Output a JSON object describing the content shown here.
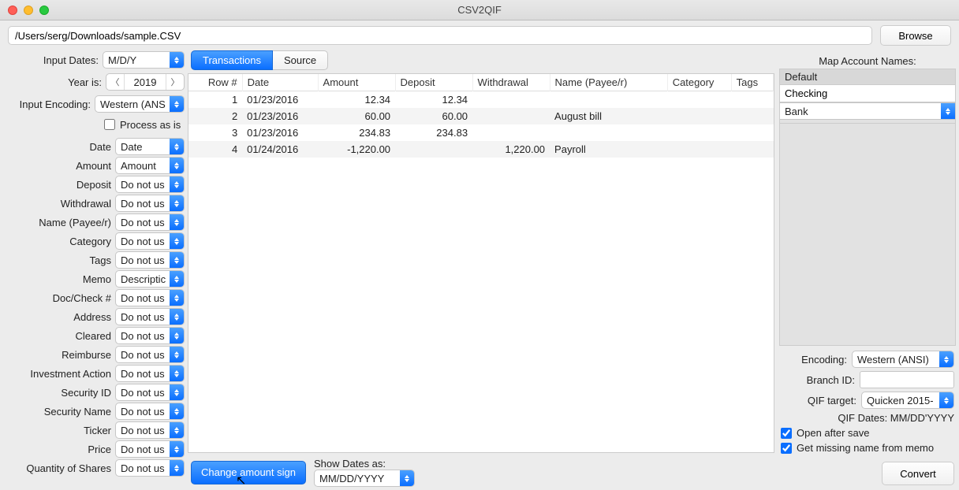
{
  "window": {
    "title": "CSV2QIF"
  },
  "path": {
    "value": "/Users/serg/Downloads/sample.CSV",
    "browse_label": "Browse"
  },
  "sidebar": {
    "input_dates_label": "Input Dates:",
    "input_dates_value": "M/D/Y",
    "year_label": "Year is:",
    "year_value": "2019",
    "encoding_label": "Input Encoding:",
    "encoding_value": "Western (ANS",
    "process_as_is_label": "Process as is",
    "fields": [
      {
        "label": "Date",
        "value": "Date"
      },
      {
        "label": "Amount",
        "value": "Amount"
      },
      {
        "label": "Deposit",
        "value": "Do not us"
      },
      {
        "label": "Withdrawal",
        "value": "Do not us"
      },
      {
        "label": "Name (Payee/r)",
        "value": "Do not us"
      },
      {
        "label": "Category",
        "value": "Do not us"
      },
      {
        "label": "Tags",
        "value": "Do not us"
      },
      {
        "label": "Memo",
        "value": "Descriptic"
      },
      {
        "label": "Doc/Check #",
        "value": "Do not us"
      },
      {
        "label": "Address",
        "value": "Do not us"
      },
      {
        "label": "Cleared",
        "value": "Do not us"
      },
      {
        "label": "Reimburse",
        "value": "Do not us"
      },
      {
        "label": "Investment Action",
        "value": "Do not us"
      },
      {
        "label": "Security ID",
        "value": "Do not us"
      },
      {
        "label": "Security Name",
        "value": "Do not us"
      },
      {
        "label": "Ticker",
        "value": "Do not us"
      },
      {
        "label": "Price",
        "value": "Do not us"
      },
      {
        "label": "Quantity of Shares",
        "value": "Do not us"
      }
    ]
  },
  "center": {
    "tabs": [
      "Transactions",
      "Source"
    ],
    "active_tab": 0,
    "columns": [
      "Row #",
      "Date",
      "Amount",
      "Deposit",
      "Withdrawal",
      "Name (Payee/r)",
      "Category",
      "Tags"
    ],
    "rows": [
      {
        "rownum": "1",
        "date": "01/23/2016",
        "amount": "12.34",
        "deposit": "12.34",
        "withdrawal": "",
        "name": "",
        "category": "",
        "tags": ""
      },
      {
        "rownum": "2",
        "date": "01/23/2016",
        "amount": "60.00",
        "deposit": "60.00",
        "withdrawal": "",
        "name": "August bill",
        "category": "",
        "tags": ""
      },
      {
        "rownum": "3",
        "date": "01/23/2016",
        "amount": "234.83",
        "deposit": "234.83",
        "withdrawal": "",
        "name": "",
        "category": "",
        "tags": ""
      },
      {
        "rownum": "4",
        "date": "01/24/2016",
        "amount": "-1,220.00",
        "deposit": "",
        "withdrawal": "1,220.00",
        "name": "Payroll",
        "category": "",
        "tags": ""
      }
    ],
    "change_sign_label": "Change amount sign",
    "show_dates_label": "Show Dates as:",
    "show_dates_value": "MM/DD/YYYY"
  },
  "right": {
    "map_title": "Map Account Names:",
    "default_label": "Default",
    "default_value": "Checking",
    "bank_value": "Bank",
    "encoding_label": "Encoding:",
    "encoding_value": "Western (ANSI)",
    "branch_label": "Branch ID:",
    "branch_value": "",
    "qif_target_label": "QIF target:",
    "qif_target_value": "Quicken 2015-",
    "qif_dates_label": "QIF Dates: MM/DD'YYYY",
    "open_after_label": "Open after save",
    "get_missing_label": "Get missing name from memo",
    "convert_label": "Convert"
  }
}
